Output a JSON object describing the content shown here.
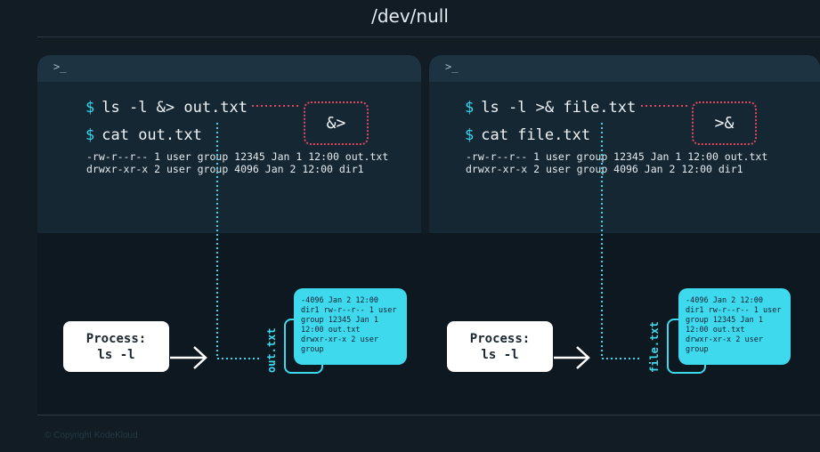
{
  "title": "/dev/null",
  "copyright": "© Copyright KodeKloud",
  "colors": {
    "accent": "#36d6ee",
    "operator_border": "#e04862",
    "file": "#3fd9ee"
  },
  "panels": [
    {
      "prompt_icon": ">_",
      "command1": "ls -l &> out.txt",
      "command2": "cat out.txt",
      "output": "-rw-r--r-- 1 user group 12345 Jan 1 12:00 out.txt\ndrwxr-xr-x 2 user group 4096 Jan 2 12:00 dir1",
      "operator": "&>",
      "process_label": "Process:",
      "process_cmd": "ls -l",
      "file_name": "out.txt",
      "file_content": "-4096 Jan 2 12:00\ndir1 rw-r--r-- 1 user\ngroup 12345 Jan 1\n12:00 out.txt\ndrwxr-xr-x 2 user\ngroup"
    },
    {
      "prompt_icon": ">_",
      "command1": "ls -l >& file.txt",
      "command2": "cat file.txt",
      "output": "-rw-r--r-- 1 user group 12345 Jan 1 12:00 out.txt\ndrwxr-xr-x 2 user group 4096 Jan 2 12:00 dir1",
      "operator": ">&",
      "process_label": "Process:",
      "process_cmd": "ls -l",
      "file_name": "file.txt",
      "file_content": "-4096 Jan 2 12:00\ndir1 rw-r--r-- 1 user\ngroup 12345 Jan 1\n12:00 out.txt\ndrwxr-xr-x 2 user\ngroup"
    }
  ]
}
